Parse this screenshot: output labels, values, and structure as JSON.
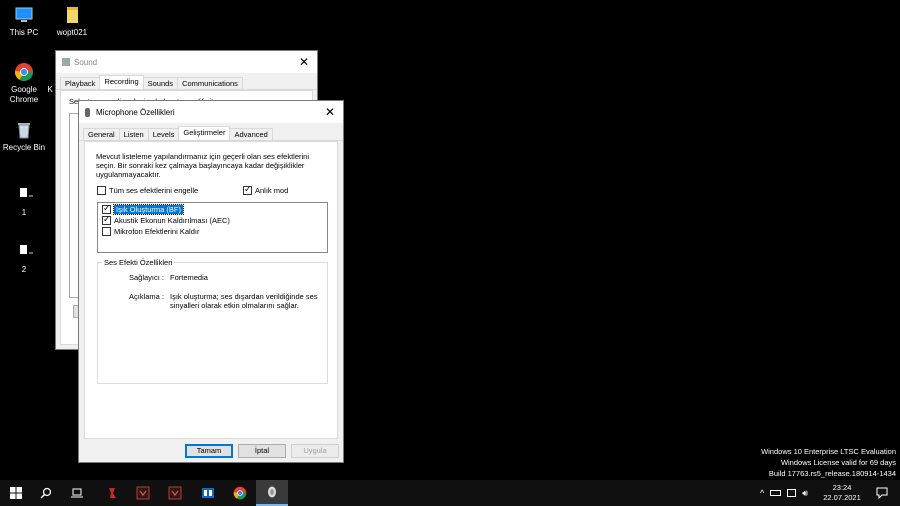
{
  "desktop": {
    "icons": [
      {
        "label": "This PC"
      },
      {
        "label": "wopt021"
      },
      {
        "label": "Google Chrome"
      },
      {
        "label": "K"
      },
      {
        "label": "Recycle Bin"
      },
      {
        "label": "1"
      },
      {
        "label": "2"
      }
    ]
  },
  "sound_window": {
    "title": "Sound",
    "tabs": [
      "Playback",
      "Recording",
      "Sounds",
      "Communications"
    ],
    "active_tab": "Recording",
    "partial_text": "Select a recording device below to modify its settings:"
  },
  "mic_window": {
    "title": "Microphone Özellikleri",
    "tabs": [
      "General",
      "Listen",
      "Levels",
      "Geliştirmeler",
      "Advanced"
    ],
    "active_tab": "Geliştirmeler",
    "description": "Mevcut listeleme yapılandırmanız için geçerli olan ses efektlerini seçin. Bir sonraki kez çalmaya başlayıncaya kadar değişiklikler uygulanmayacaktır.",
    "disable_all_label": "Tüm ses efektlerini engelle",
    "disable_all_checked": false,
    "instant_mode_label": "Anlık mod",
    "instant_mode_checked": true,
    "effects": [
      {
        "label": "Işık Oluşturma (BF)",
        "checked": true,
        "selected": true
      },
      {
        "label": "Akustik Ekonun Kaldırılması (AEC)",
        "checked": true,
        "selected": false
      },
      {
        "label": "Mikrofon Efektlerini Kaldır",
        "checked": false,
        "selected": false
      }
    ],
    "props_group_title": "Ses Efekti Özellikleri",
    "provider_label": "Sağlayıcı :",
    "provider_value": "Fortemedia",
    "desc_label": "Açıklama :",
    "desc_value": "Işık oluşturma; ses dışardan verildiğinde ses sinyalleri olarak etkin olmalarını sağlar.",
    "buttons": {
      "ok": "Tamam",
      "cancel": "İptal",
      "apply": "Uygula"
    }
  },
  "watermark": {
    "line1": "Windows 10 Enterprise LTSC Evaluation",
    "line2": "Windows License valid for 69 days",
    "line3": "Build 17763.rs5_release.180914-1434"
  },
  "taskbar": {
    "time": "23:24",
    "date": "22.07.2021"
  },
  "colors": {
    "accent": "#0078d7",
    "selection": "#0078d7",
    "taskbar": "#101010"
  }
}
